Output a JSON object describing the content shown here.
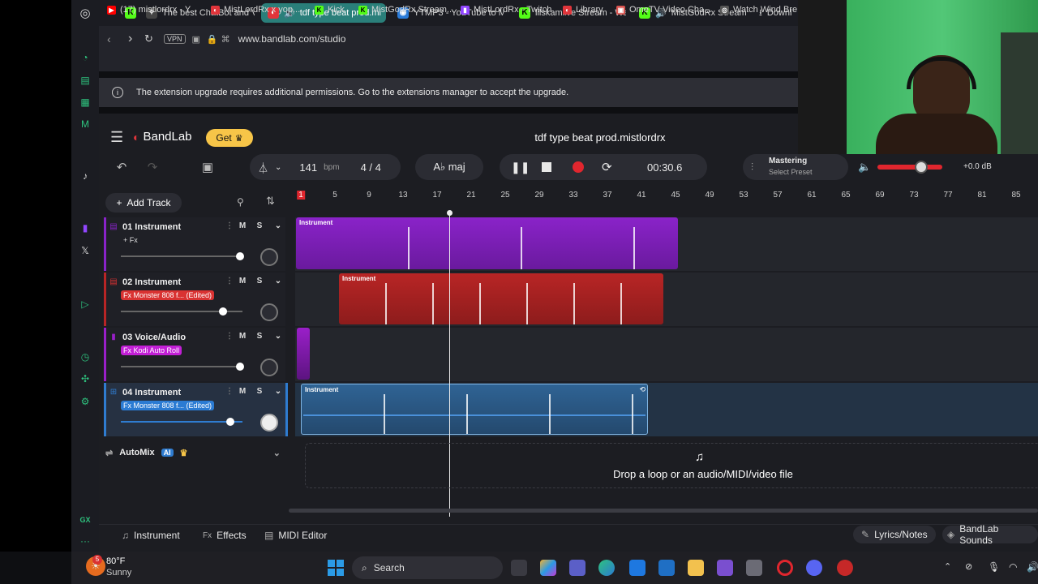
{
  "browser": {
    "tabs": [
      {
        "label": "The best ChatBot and V",
        "icon": "chatgpt-icon",
        "color": "#7a7a7a"
      },
      {
        "label": "tdf type beat prod.mi",
        "icon": "audio-tab-icon",
        "color": "#e0353b",
        "active": true
      },
      {
        "label": "YTMP3 - YouTube to M",
        "icon": "ytmp3-icon",
        "color": "#2a7bd8"
      },
      {
        "label": "lilskamlive Stream - Wa",
        "icon": "kick-icon",
        "color": "#53fc18"
      },
      {
        "label": "MistGodRx Stream",
        "icon": "kick-icon",
        "color": "#53fc18"
      },
      {
        "label": "Downl",
        "icon": "download-icon",
        "color": "#999999"
      }
    ],
    "url": "www.bandlab.com/studio",
    "vpn": "VPN",
    "bookmarks": [
      {
        "label": "(17) mistlordrx - Y...",
        "color": "#ff0000"
      },
      {
        "label": "MistLordRx x yop...",
        "color": "#e0353b"
      },
      {
        "label": "Kick",
        "color": "#53fc18"
      },
      {
        "label": "MistGodRx Stream...",
        "color": "#53fc18"
      },
      {
        "label": "MistLordRx - Twitch",
        "color": "#9146ff"
      },
      {
        "label": "Library",
        "color": "#e0353b"
      },
      {
        "label": "OmeTV Video Cha...",
        "color": "#d9534f"
      },
      {
        "label": "Watch Wind Bre",
        "color": "#aaaaaa"
      }
    ],
    "notice": "The extension upgrade requires additional permissions. Go to the extensions manager to accept the upgrade."
  },
  "bandlab": {
    "logo": "BandLab",
    "get_label": "Get",
    "project_title": "tdf type beat prod.mistlordrx",
    "tempo": "141",
    "tempo_unit": "bpm",
    "time_sig": "4 / 4",
    "key": "A♭ maj",
    "time": "00:30.6",
    "mastering_label": "Mastering",
    "mastering_sub": "Select Preset",
    "volume_db": "+0.0 dB",
    "add_track": "Add Track",
    "ruler": [
      "1",
      "5",
      "9",
      "13",
      "17",
      "21",
      "25",
      "29",
      "33",
      "37",
      "41",
      "45",
      "49",
      "53",
      "57",
      "61",
      "65",
      "69",
      "73",
      "77",
      "81",
      "85"
    ],
    "tracks": [
      {
        "name": "01  Instrument",
        "fx": "+ Fx",
        "fx_color": "#1f2026",
        "color": "#8a23c9",
        "volume": 0.98,
        "clip_label": "Instrument"
      },
      {
        "name": "02  Instrument",
        "fx": "Fx Monster 808 f...  (Edited)",
        "fx_color": "#d93232",
        "color": "#b82525",
        "volume": 0.84,
        "clip_label": "Instrument"
      },
      {
        "name": "03  Voice/Audio",
        "fx": "Fx Kodi Auto Roll",
        "fx_color": "#c21fd6",
        "color": "#9a1fc9",
        "volume": 0.98,
        "clip_label": ""
      },
      {
        "name": "04  Instrument",
        "fx": "Fx Monster 808 f...  (Edited)",
        "fx_color": "#2b7bd3",
        "color": "#2f5f8a",
        "volume": 0.9,
        "clip_label": "Instrument"
      }
    ],
    "automix": "AutoMix",
    "ai_badge": "AI",
    "drop_text": "Drop a loop or an audio/MIDI/video file",
    "bottom": {
      "instrument": "Instrument",
      "effects": "Effects",
      "midi_editor": "MIDI Editor",
      "lyrics": "Lyrics/Notes",
      "sounds": "BandLab Sounds"
    }
  },
  "taskbar": {
    "weather_temp": "80°F",
    "weather_desc": "Sunny",
    "search": "Search",
    "weather_badge": "5"
  }
}
